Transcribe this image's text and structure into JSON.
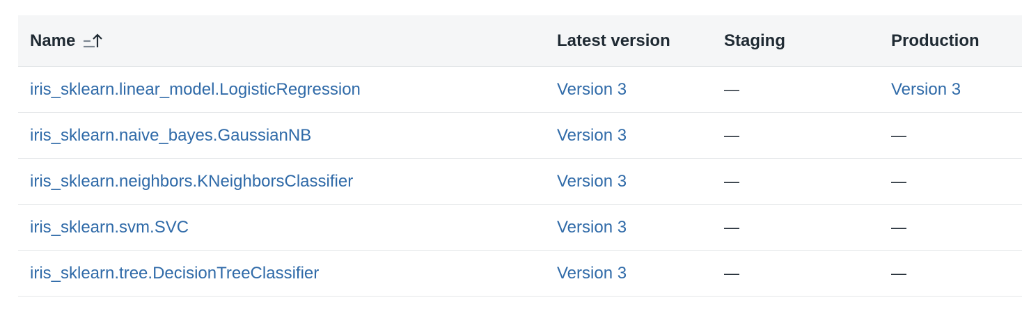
{
  "table": {
    "headers": {
      "name": "Name",
      "latest_version": "Latest version",
      "staging": "Staging",
      "production": "Production"
    },
    "sort_icon": "sort-ascending-icon",
    "rows": [
      {
        "name": "iris_sklearn.linear_model.LogisticRegression",
        "latest_version": "Version 3",
        "staging": "—",
        "production": "Version 3"
      },
      {
        "name": "iris_sklearn.naive_bayes.GaussianNB",
        "latest_version": "Version 3",
        "staging": "—",
        "production": "—"
      },
      {
        "name": "iris_sklearn.neighbors.KNeighborsClassifier",
        "latest_version": "Version 3",
        "staging": "—",
        "production": "—"
      },
      {
        "name": "iris_sklearn.svm.SVC",
        "latest_version": "Version 3",
        "staging": "—",
        "production": "—"
      },
      {
        "name": "iris_sklearn.tree.DecisionTreeClassifier",
        "latest_version": "Version 3",
        "staging": "—",
        "production": "—"
      }
    ]
  },
  "colors": {
    "link": "#2f6aa8",
    "header_bg": "#f5f6f7",
    "text": "#1f2a33",
    "divider": "#e3e6e8"
  }
}
